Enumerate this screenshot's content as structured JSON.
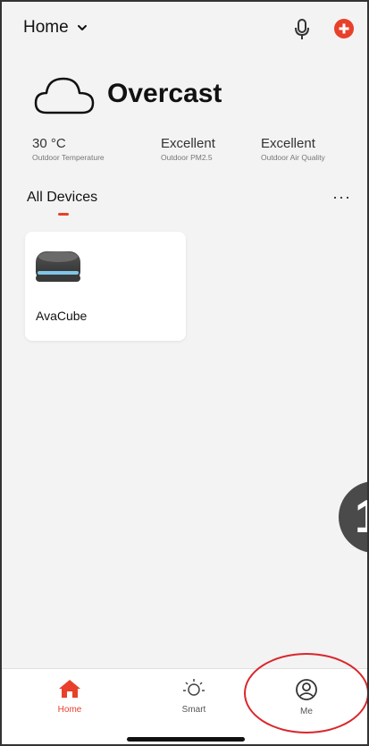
{
  "header": {
    "home_label": "Home"
  },
  "weather": {
    "condition": "Overcast",
    "stats": [
      {
        "value": "30 °C",
        "label": "Outdoor Temperature"
      },
      {
        "value": "Excellent",
        "label": "Outdoor PM2.5"
      },
      {
        "value": "Excellent",
        "label": "Outdoor Air Quality"
      }
    ]
  },
  "devices": {
    "title": "All Devices",
    "more": "···",
    "items": [
      {
        "name": "AvaCube"
      }
    ]
  },
  "floating": {
    "text": "1"
  },
  "nav": {
    "items": [
      {
        "label": "Home"
      },
      {
        "label": "Smart"
      },
      {
        "label": "Me"
      }
    ]
  },
  "colors": {
    "accent": "#e8402a",
    "annotation": "#d9262b"
  }
}
